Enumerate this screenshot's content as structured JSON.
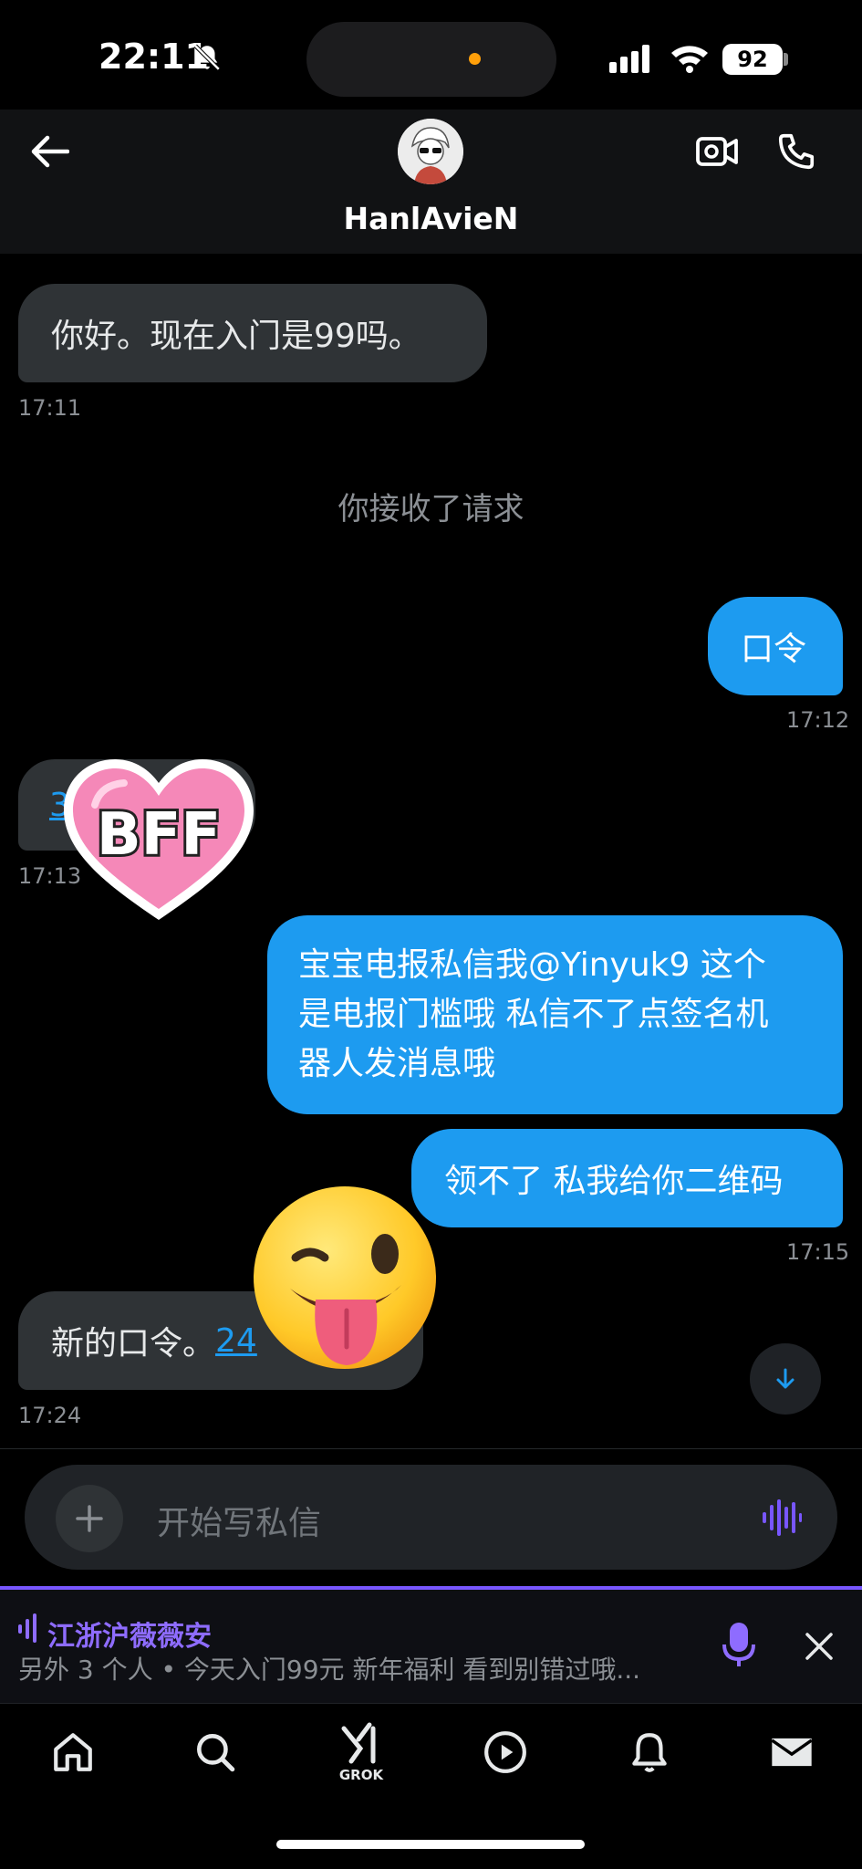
{
  "status_bar": {
    "time": "22:11",
    "battery": "92"
  },
  "header": {
    "back_label": "←",
    "username": "HanlAvieN"
  },
  "messages": {
    "m1": {
      "text": "你好。现在入门是99吗。",
      "time": "17:11"
    },
    "system": "你接收了请求",
    "m2": {
      "text": "口令",
      "time": "17:12"
    },
    "m3": {
      "link": "3",
      "time": "17:13"
    },
    "m4": {
      "line1": "宝宝电报私信我@Yinyuk9  这个",
      "line2": "是电报门槛哦 私信不了点签名机",
      "line3": "器人发消息哦"
    },
    "m5": {
      "text": "领不了 私我给你二维码",
      "time": "17:15"
    },
    "m6": {
      "text": "新的口令。",
      "link": "24",
      "time": "17:24"
    }
  },
  "stickers": {
    "bff": "BFF"
  },
  "composer": {
    "placeholder": "开始写私信"
  },
  "space_bar": {
    "title": "江浙沪薇薇安",
    "subtitle": "另外 3 个人 • 今天入门99元 新年福利 看到别错过哦..."
  },
  "tabbar": {
    "grok_label": "GROK"
  },
  "colors": {
    "accent": "#1d9bf0",
    "spaces": "#7856ff",
    "bubble_in": "#2f3336"
  }
}
